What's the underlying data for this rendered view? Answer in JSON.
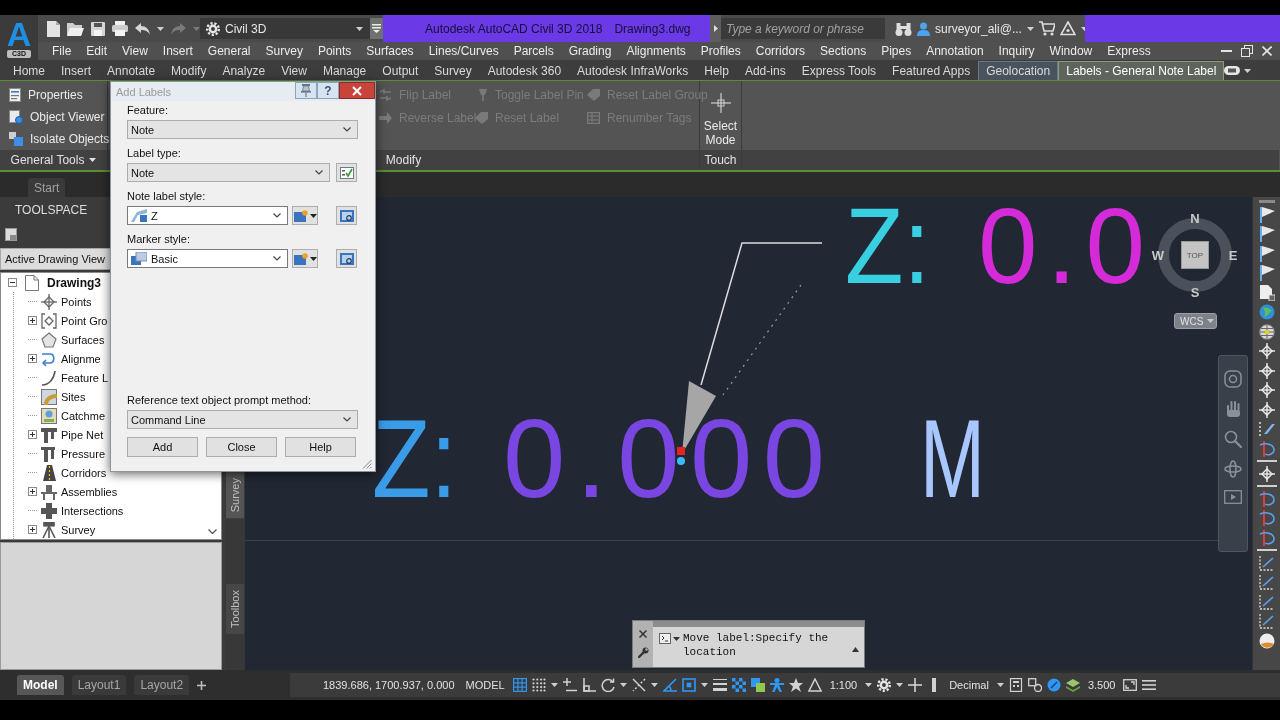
{
  "app_button": {
    "letter": "A",
    "badge": "C3D"
  },
  "title_bar": {
    "workspace": "Civil 3D",
    "title": "Autodesk AutoCAD Civil 3D 2018",
    "document": "Drawing3.dwg",
    "search": {
      "placeholder": "Type a keyword or phrase"
    },
    "user": "surveyor_ali@..."
  },
  "menu_bar": [
    "File",
    "Edit",
    "View",
    "Insert",
    "General",
    "Survey",
    "Points",
    "Surfaces",
    "Lines/Curves",
    "Parcels",
    "Grading",
    "Alignments",
    "Profiles",
    "Corridors",
    "Sections",
    "Pipes",
    "Annotation",
    "Inquiry",
    "Window",
    "Express"
  ],
  "ribbon_tabs": [
    {
      "label": "Home",
      "selected": false,
      "contextual": false
    },
    {
      "label": "Insert",
      "selected": false,
      "contextual": false
    },
    {
      "label": "Annotate",
      "selected": false,
      "contextual": false
    },
    {
      "label": "Modify",
      "selected": false,
      "contextual": false
    },
    {
      "label": "Analyze",
      "selected": false,
      "contextual": false
    },
    {
      "label": "View",
      "selected": false,
      "contextual": false
    },
    {
      "label": "Manage",
      "selected": false,
      "contextual": false
    },
    {
      "label": "Output",
      "selected": false,
      "contextual": false
    },
    {
      "label": "Survey",
      "selected": false,
      "contextual": false
    },
    {
      "label": "Autodesk 360",
      "selected": false,
      "contextual": false
    },
    {
      "label": "Autodesk InfraWorks",
      "selected": false,
      "contextual": false
    },
    {
      "label": "Help",
      "selected": false,
      "contextual": false
    },
    {
      "label": "Add-ins",
      "selected": false,
      "contextual": false
    },
    {
      "label": "Express Tools",
      "selected": false,
      "contextual": false
    },
    {
      "label": "Featured Apps",
      "selected": false,
      "contextual": false
    },
    {
      "label": "Geolocation",
      "selected": false,
      "contextual": true
    },
    {
      "label": "Labels - General Note Label",
      "selected": true,
      "contextual": true
    }
  ],
  "ribbon_panels": [
    {
      "kind": "list",
      "title": "General Tools",
      "dropdown": true,
      "buttons": [
        {
          "label": "Properties",
          "disabled": false
        },
        {
          "label": "Object Viewer",
          "disabled": false
        },
        {
          "label": "Isolate Objects",
          "disabled": false
        }
      ]
    },
    {
      "kind": "grid",
      "title": "Modify",
      "dropdown": false,
      "buttons": [
        {
          "label": "Flip Label",
          "disabled": true
        },
        {
          "label": "Toggle Label Pin",
          "disabled": true
        },
        {
          "label": "Reset Label Group",
          "disabled": true
        },
        {
          "label": "Reverse Label",
          "disabled": true
        },
        {
          "label": "Reset Label",
          "disabled": true
        },
        {
          "label": "Renumber Tags",
          "disabled": true
        }
      ]
    },
    {
      "kind": "large",
      "title": "Touch",
      "dropdown": false,
      "buttons": [
        {
          "label": "Select Mode",
          "disabled": false
        }
      ]
    }
  ],
  "file_tabs": [
    {
      "label": "Start",
      "selected": false
    }
  ],
  "toolspace": {
    "title": "TOOLSPACE",
    "view": "Active Drawing View",
    "tree": [
      {
        "label": "Drawing3",
        "kind": "folder",
        "expanded": true,
        "children": [
          {
            "label": "Points",
            "kind": "leaf"
          },
          {
            "label": "Point Gro",
            "kind": "folder",
            "expanded": false
          },
          {
            "label": "Surfaces",
            "kind": "leaf"
          },
          {
            "label": "Alignme",
            "kind": "folder",
            "expanded": false
          },
          {
            "label": "Feature L",
            "kind": "leaf"
          },
          {
            "label": "Sites",
            "kind": "leaf"
          },
          {
            "label": "Catchme",
            "kind": "leaf"
          },
          {
            "label": "Pipe Net",
            "kind": "folder",
            "expanded": false
          },
          {
            "label": "Pressure",
            "kind": "leaf"
          },
          {
            "label": "Corridors",
            "kind": "leaf"
          },
          {
            "label": "Assemblies",
            "kind": "folder",
            "expanded": false
          },
          {
            "label": "Intersections",
            "kind": "leaf"
          },
          {
            "label": "Survey",
            "kind": "folder",
            "expanded": false
          }
        ]
      }
    ],
    "side_tabs": [
      "Survey",
      "Toolbox"
    ]
  },
  "dialog": {
    "title": "Add Labels",
    "help": "?",
    "fields": [
      {
        "kind": "select",
        "label": "Feature:",
        "value": "Note"
      },
      {
        "kind": "select-action",
        "label": "Label type:",
        "value": "Note"
      },
      {
        "kind": "style",
        "label": "Note label style:",
        "value": "Z"
      },
      {
        "kind": "style",
        "label": "Marker style:",
        "value": "Basic"
      }
    ],
    "prompt_field": {
      "label": "Reference text object prompt method:",
      "value": "Command Line"
    },
    "buttons": [
      "Add",
      "Close",
      "Help"
    ]
  },
  "canvas": {
    "labels": [
      {
        "parts": [
          {
            "text": "Z:",
            "color": "#38d0e0"
          },
          {
            "text": "0.0",
            "color": "#d42ad8"
          }
        ]
      },
      {
        "parts": [
          {
            "text": "Z:",
            "color": "#3a9ce8"
          },
          {
            "text": "0.000",
            "color": "#7a46e2"
          },
          {
            "text": "M",
            "color": "#a8c6ff"
          }
        ]
      }
    ],
    "viewcube": {
      "face": "TOP",
      "north": "N",
      "south": "S",
      "east": "E",
      "west": "W",
      "ucs": "WCS"
    }
  },
  "command_line": {
    "text": "Move label:Specify the location"
  },
  "layout_tabs": [
    {
      "label": "Model",
      "selected": true
    },
    {
      "label": "Layout1",
      "selected": false
    },
    {
      "label": "Layout2",
      "selected": false
    }
  ],
  "status_bar": {
    "coordinates": "1839.686, 1700.937, 0.000",
    "space": "MODEL",
    "scale": "1:100",
    "units": "Decimal",
    "value": "3.500",
    "toggles": [
      {
        "on": true
      },
      {
        "on": false
      },
      {
        "on": false
      },
      {
        "on": false
      },
      {
        "on": false
      },
      {
        "on": false
      },
      {
        "on": true
      },
      {
        "on": true
      },
      {
        "on": false
      },
      {
        "on": true
      },
      {
        "on": true
      },
      {
        "on": true
      },
      {
        "on": false
      },
      {
        "on": true
      }
    ]
  }
}
